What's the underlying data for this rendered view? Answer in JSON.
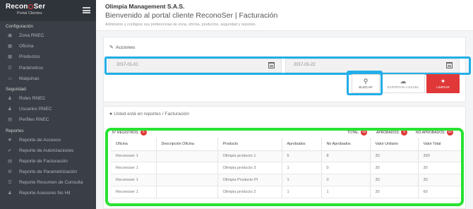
{
  "sidebar": {
    "logo_main": [
      "Recon",
      "Ser"
    ],
    "logo_sub": "Portal Clientes",
    "sections": [
      {
        "title": "Configuración",
        "items": [
          {
            "label": "Zona RNEC",
            "icon": "map-icon"
          },
          {
            "label": "Oficina",
            "icon": "office-icon"
          },
          {
            "label": "Productos",
            "icon": "box-icon"
          },
          {
            "label": "Parámetros",
            "icon": "sliders-icon"
          },
          {
            "label": "Maquinas",
            "icon": "laptop-icon"
          }
        ]
      },
      {
        "title": "Seguridad",
        "items": [
          {
            "label": "Roles RNEC",
            "icon": "users-icon"
          },
          {
            "label": "Usuarios RNEC",
            "icon": "users-icon"
          },
          {
            "label": "Perfiles RNEC",
            "icon": "id-card-icon"
          }
        ]
      },
      {
        "title": "Reportes",
        "items": [
          {
            "label": "Reporte de Accesos",
            "icon": "wrench-icon"
          },
          {
            "label": "Reporte de Autorizaciones",
            "icon": "check-icon"
          },
          {
            "label": "Reporte de Facturación",
            "icon": "invoice-icon"
          },
          {
            "label": "Reporte de Parametrización",
            "icon": "gear-icon"
          },
          {
            "label": "Reporte Resumen de Consulta",
            "icon": "list-icon"
          },
          {
            "label": "Reporte Asesores No Hit",
            "icon": "user-icon"
          }
        ]
      }
    ]
  },
  "header": {
    "company": "Olimpia Management S.A.S.",
    "welcome": "Bienvenido al portal cliente ReconoSer | Facturación",
    "description": "Administre y configure sus preferencias de zona, oficina, productos, seguridad y reportes."
  },
  "actions": {
    "title": "Acciones",
    "date_from": "2017-01-01",
    "date_to": "2017-01-22",
    "buscar_label": "BUSCAR",
    "excel_label": "EXPORTAR A EXCEL",
    "limpiar_label": "LIMPIAR"
  },
  "report": {
    "breadcrumb": "Usted está en reportes / Facturación",
    "registros_label": "N° REGISTROS:",
    "registros_count": "5",
    "total_label": "TOTAL:",
    "total_count": "15",
    "aprobados_label": "APROBADOS:",
    "aprobados_count": "5",
    "no_aprobados_label": "NO APROBADOS:",
    "no_aprobados_count": "10"
  },
  "table": {
    "columns": [
      "Oficina",
      "Descripción Oficina",
      "Producto",
      "Aprobados",
      "No Aprobados",
      "Valor Unitario",
      "Valor Total"
    ],
    "rows": [
      [
        "Reconoser 1",
        "",
        "Olimpia producto 1",
        "5",
        "8",
        "30",
        "390"
      ],
      [
        "Reconoser 1",
        "",
        "Olimpia producto 3",
        "1",
        "0",
        "30",
        "30"
      ],
      [
        "Reconoser 1",
        "",
        "Olimpia Producto PI",
        "1",
        "0",
        "30",
        "30"
      ],
      [
        "Reconoser 1",
        "",
        "Olimpia producto 2",
        "1",
        "1",
        "30",
        "60"
      ]
    ]
  },
  "colors": {
    "sidebar_bg": "#3a3f47",
    "accent_red": "#e03838",
    "highlight_blue": "#21aee8",
    "highlight_green": "#28e233"
  }
}
